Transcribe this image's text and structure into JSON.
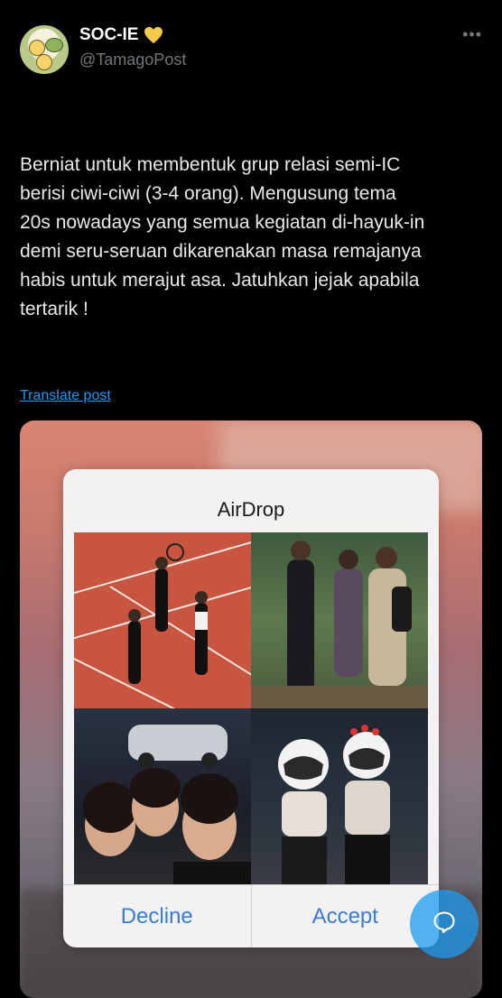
{
  "author": {
    "name": "SOC-IE",
    "handle": "@TamagoPost",
    "heart": "yellow-heart-icon"
  },
  "post": {
    "text": "Berniat untuk membentuk grup relasi semi-IC\nberisi ciwi-ciwi (3-4 orang). Mengusung tema\n20s nowadays yang semua kegiatan di-hayuk-in\ndemi seru-seruan dikarenakan masa remajanya\nhabis untuk merajut asa. Jatuhkan jejak apabila\ntertarik !",
    "translate": "Translate post"
  },
  "airdrop": {
    "title": "AirDrop",
    "decline": "Decline",
    "accept": "Accept"
  },
  "colors": {
    "link": "#1d9bf0",
    "heart": "#f7c948",
    "ios_button": "#3a7bd5"
  }
}
